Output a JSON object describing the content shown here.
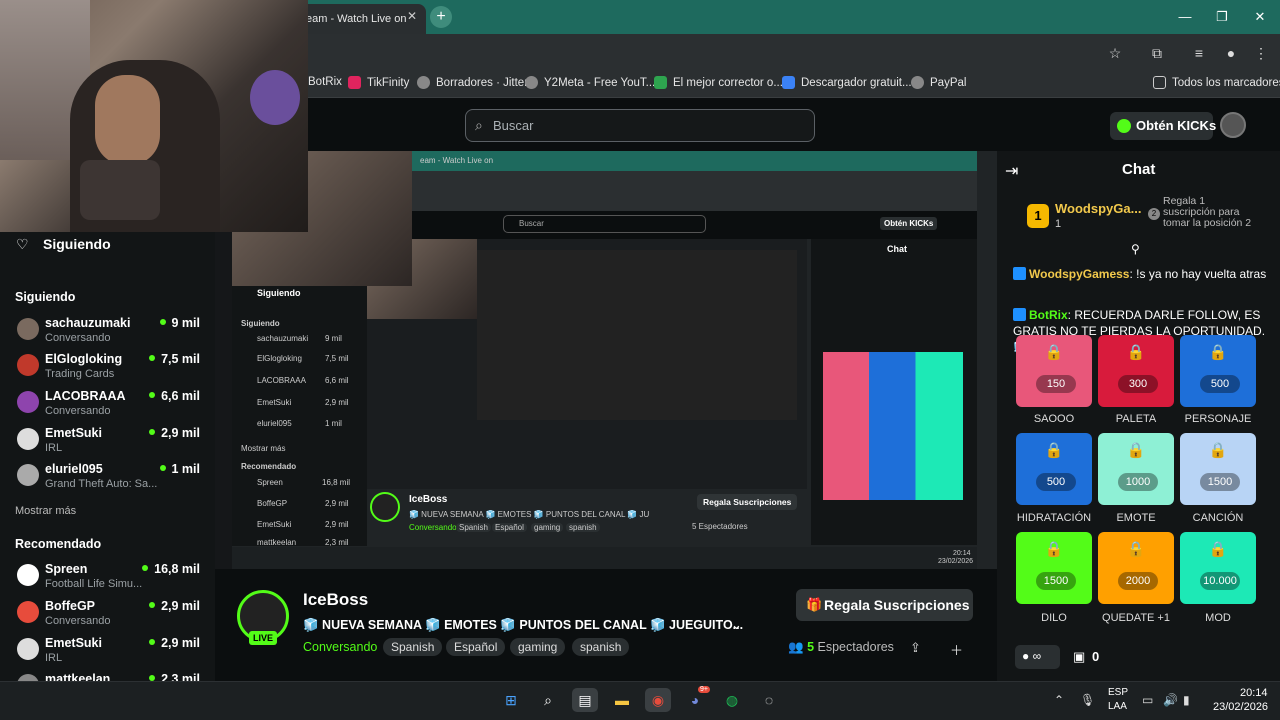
{
  "browser": {
    "tab_title": "eam - Watch Live on",
    "bookmarks": [
      {
        "label": "BotRix",
        "color": "#1e90ff"
      },
      {
        "label": "TikFinity",
        "color": "#e0245e"
      },
      {
        "label": "Borradores · Jitter",
        "color": "#888888"
      },
      {
        "label": "Y2Meta - Free YouT...",
        "color": "#888888"
      },
      {
        "label": "El mejor corrector o...",
        "color": "#2ea44f"
      },
      {
        "label": "Descargador gratuit...",
        "color": "#3b82f6"
      },
      {
        "label": "PayPal",
        "color": "#888888"
      }
    ],
    "all_bookmarks": "Todos los marcadores"
  },
  "header": {
    "search_placeholder": "Buscar",
    "kicks_label": "Obtén KICKs"
  },
  "sidebar": {
    "following_header": "Siguiendo",
    "following_title": "Siguiendo",
    "following": [
      {
        "name": "sachauzumaki",
        "sub": "Conversando",
        "viewers": "9 mil",
        "color": "#7a6a5f"
      },
      {
        "name": "ElGlogloking",
        "sub": "Trading Cards",
        "viewers": "7,5 mil",
        "color": "#c0392b"
      },
      {
        "name": "LACOBRAAA",
        "sub": "Conversando",
        "viewers": "6,6 mil",
        "color": "#8e44ad"
      },
      {
        "name": "EmetSuki",
        "sub": "IRL",
        "viewers": "2,9 mil",
        "color": "#dddddd"
      },
      {
        "name": "eluriel095",
        "sub": "Grand Theft Auto: Sa...",
        "viewers": "1 mil",
        "color": "#aaaaaa"
      }
    ],
    "show_more": "Mostrar más",
    "recommended_title": "Recomendado",
    "recommended": [
      {
        "name": "Spreen",
        "sub": "Football Life Simu...",
        "viewers": "16,8 mil",
        "color": "#ffffff"
      },
      {
        "name": "BoffeGP",
        "sub": "Conversando",
        "viewers": "2,9 mil",
        "color": "#e74c3c"
      },
      {
        "name": "EmetSuki",
        "sub": "IRL",
        "viewers": "2,9 mil",
        "color": "#dddddd"
      },
      {
        "name": "mattkeelan",
        "sub": "",
        "viewers": "2,3 mil",
        "color": "#888888"
      }
    ]
  },
  "stream": {
    "streamer": "IceBoss",
    "live": "LIVE",
    "title": "🧊 NUEVA SEMANA 🧊 EMOTES 🧊 PUNTOS DEL CANAL 🧊 JUEGUITO...",
    "category": "Conversando",
    "tags": [
      "Spanish",
      "Español",
      "gaming",
      "spanish"
    ],
    "gift_button": "Regala Suscripciones",
    "viewers_count": "5",
    "viewers_label": "Espectadores"
  },
  "nested": {
    "tab_title": "eam - Watch Live on",
    "search": "Buscar",
    "kicks": "Obtén KICKs",
    "chat": "Chat",
    "streamer": "IceBoss",
    "gift": "Regala Suscripciones",
    "viewers": "5 Espectadores",
    "title": "🧊 NUEVA SEMANA 🧊 EMOTES 🧊 PUNTOS DEL CANAL 🧊 JUEGUITO...",
    "category": "Conversando",
    "tags": [
      "Spanish",
      "Español",
      "gaming",
      "spanish"
    ],
    "siguiendo": "Siguiendo",
    "side_items": [
      "sachauzumaki",
      "ElGlogloking",
      "LACOBRAAA",
      "EmetSuki",
      "eluriel095"
    ],
    "side_counts": [
      "9 mil",
      "7,5 mil",
      "6,6 mil",
      "2,9 mil",
      "1 mil"
    ],
    "recomendado": "Recomendado",
    "rec_items": [
      "Spreen",
      "BoffeGP",
      "EmetSuki",
      "mattkeelan"
    ],
    "rec_counts": [
      "16,8 mil",
      "2,9 mil",
      "2,9 mil",
      "2,3 mil"
    ],
    "mostrar": "Mostrar más",
    "time": "20:14",
    "date": "23/02/2026"
  },
  "chat": {
    "title": "Chat",
    "top_rank": "1",
    "top_user": "WoodspyGa...",
    "top_count": "1",
    "slot_two": "2",
    "gift_prompt": "Regala 1 suscripción para tomar la posición 2",
    "messages": [
      {
        "user": "WoodspyGamess",
        "text": ": !s ya no hay vuelta atras"
      },
      {
        "user": "BotRix",
        "text": ": RECUERDA DARLE FOLLOW, ES GRATIS NO TE PIERDAS LA OPORTUNIDAD. 🧊"
      }
    ],
    "rewards": [
      {
        "label": "SAOOO",
        "cost": "150",
        "color": "#e8577a"
      },
      {
        "label": "PALETA",
        "cost": "300",
        "color": "#d81b3c"
      },
      {
        "label": "PERSONAJE",
        "cost": "500",
        "color": "#1e6fd9"
      },
      {
        "label": "HIDRATACIÓN",
        "cost": "500",
        "color": "#1e6fd9"
      },
      {
        "label": "EMOTE",
        "cost": "1000",
        "color": "#8ef0d5"
      },
      {
        "label": "CANCIÓN",
        "cost": "1500",
        "color": "#b8d4f5"
      },
      {
        "label": "DILO",
        "cost": "1500",
        "color": "#53fc18"
      },
      {
        "label": "QUEDATE +1",
        "cost": "2000",
        "color": "#ffa000"
      },
      {
        "label": "MOD",
        "cost": "10.000",
        "color": "#1de9b6"
      }
    ],
    "points_symbol": "∞",
    "inventory_count": "0"
  },
  "taskbar": {
    "lang1": "ESP",
    "lang2": "LAA",
    "time": "20:14",
    "date": "23/02/2026",
    "discord_badge": "9+"
  }
}
